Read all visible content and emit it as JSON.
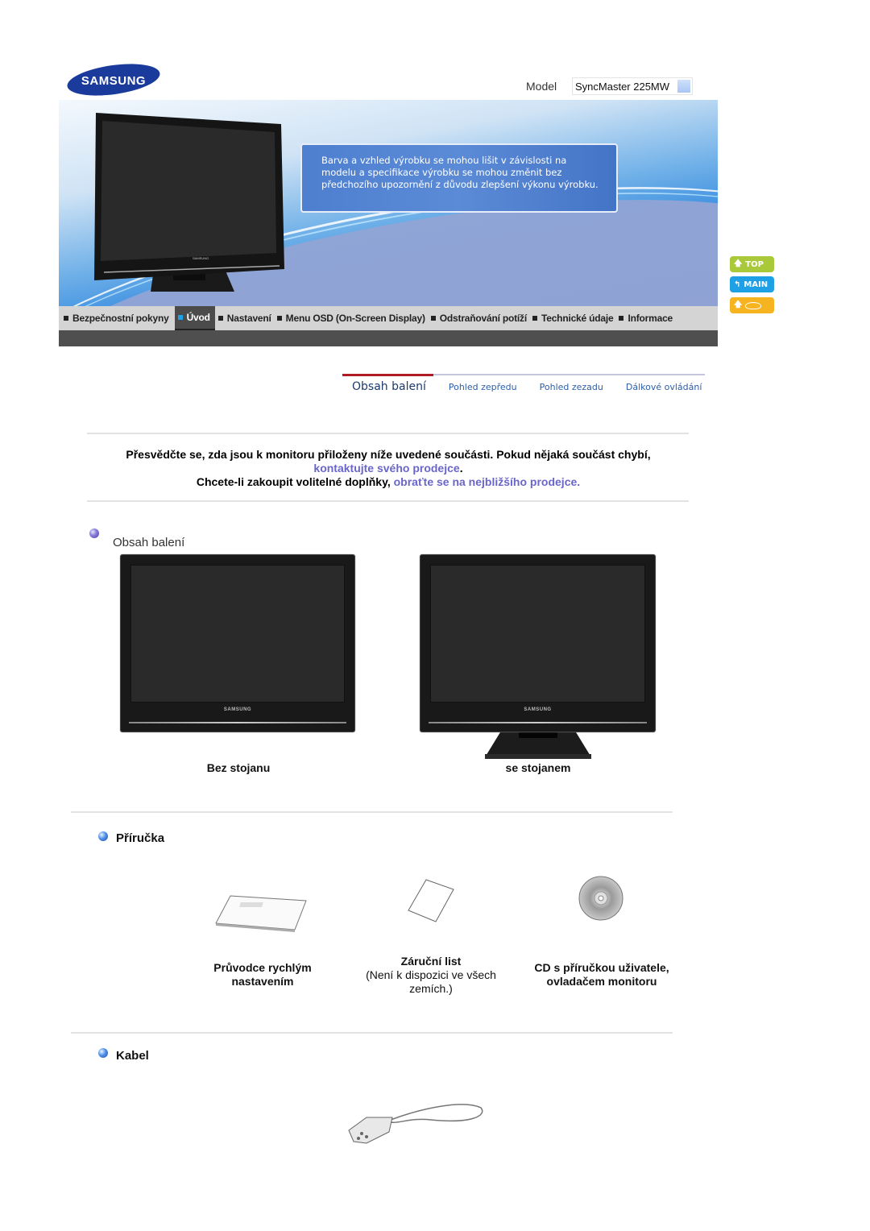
{
  "header": {
    "brand": "SAMSUNG",
    "model_label": "Model",
    "model_value": "SyncMaster 225MW"
  },
  "banner": {
    "notice": "Barva a vzhled výrobku se mohou lišit v závislosti na modelu a specifikace výrobku se mohou změnit bez předchozího upozornění z důvodu zlepšení výkonu výrobku."
  },
  "side_nav": {
    "top_label": "TOP",
    "main_label": "MAIN",
    "back_icon": "book-icon",
    "colors": {
      "top": "#a9c93a",
      "main": "#1ea0e6",
      "back": "#f6b421"
    }
  },
  "main_nav": {
    "items": [
      {
        "label": "Bezpečnostní pokyny",
        "active": false
      },
      {
        "label": "Úvod",
        "active": true
      },
      {
        "label": "Nastavení",
        "active": false
      },
      {
        "label": "Menu OSD (On-Screen Display)",
        "active": false
      },
      {
        "label": "Odstraňování potíží",
        "active": false
      },
      {
        "label": "Technické údaje",
        "active": false
      },
      {
        "label": "Informace",
        "active": false
      }
    ]
  },
  "sub_tabs": {
    "items": [
      {
        "label": "Obsah balení",
        "active": true
      },
      {
        "label": "Pohled zepředu",
        "active": false
      },
      {
        "label": "Pohled zezadu",
        "active": false
      },
      {
        "label": "Dálkové ovládání",
        "active": false
      }
    ]
  },
  "intro": {
    "line1": "Přesvědčte se, zda jsou k monitoru přiloženy níže uvedené součásti. Pokud nějaká součást chybí,",
    "link1": "kontaktujte svého prodejce",
    "line1_end": ".",
    "line2": "Chcete-li zakoupit volitelné doplňky, ",
    "link2": "obraťte se na nejbližšího prodejce.",
    "link_color": "#6a66c9"
  },
  "package": {
    "title": "Obsah balení",
    "items": [
      {
        "label": "Bez stojanu",
        "brand": "SAMSUNG"
      },
      {
        "label": "se stojanem",
        "brand": "SAMSUNG"
      }
    ]
  },
  "manual": {
    "title": "Příručka",
    "items": [
      {
        "label_line1": "Průvodce rychlým",
        "label_line2": "nastavením",
        "icon": "booklet-icon"
      },
      {
        "label_line1": "Záruční list",
        "note_line1": "(Není k dispozici ve všech",
        "note_line2": "zemích.)",
        "icon": "warranty-card-icon"
      },
      {
        "label_line1": "CD s příručkou uživatele,",
        "label_line2": "ovladačem monitoru",
        "icon": "cd-icon"
      }
    ]
  },
  "cable": {
    "title": "Kabel",
    "icon": "power-cable-icon"
  }
}
